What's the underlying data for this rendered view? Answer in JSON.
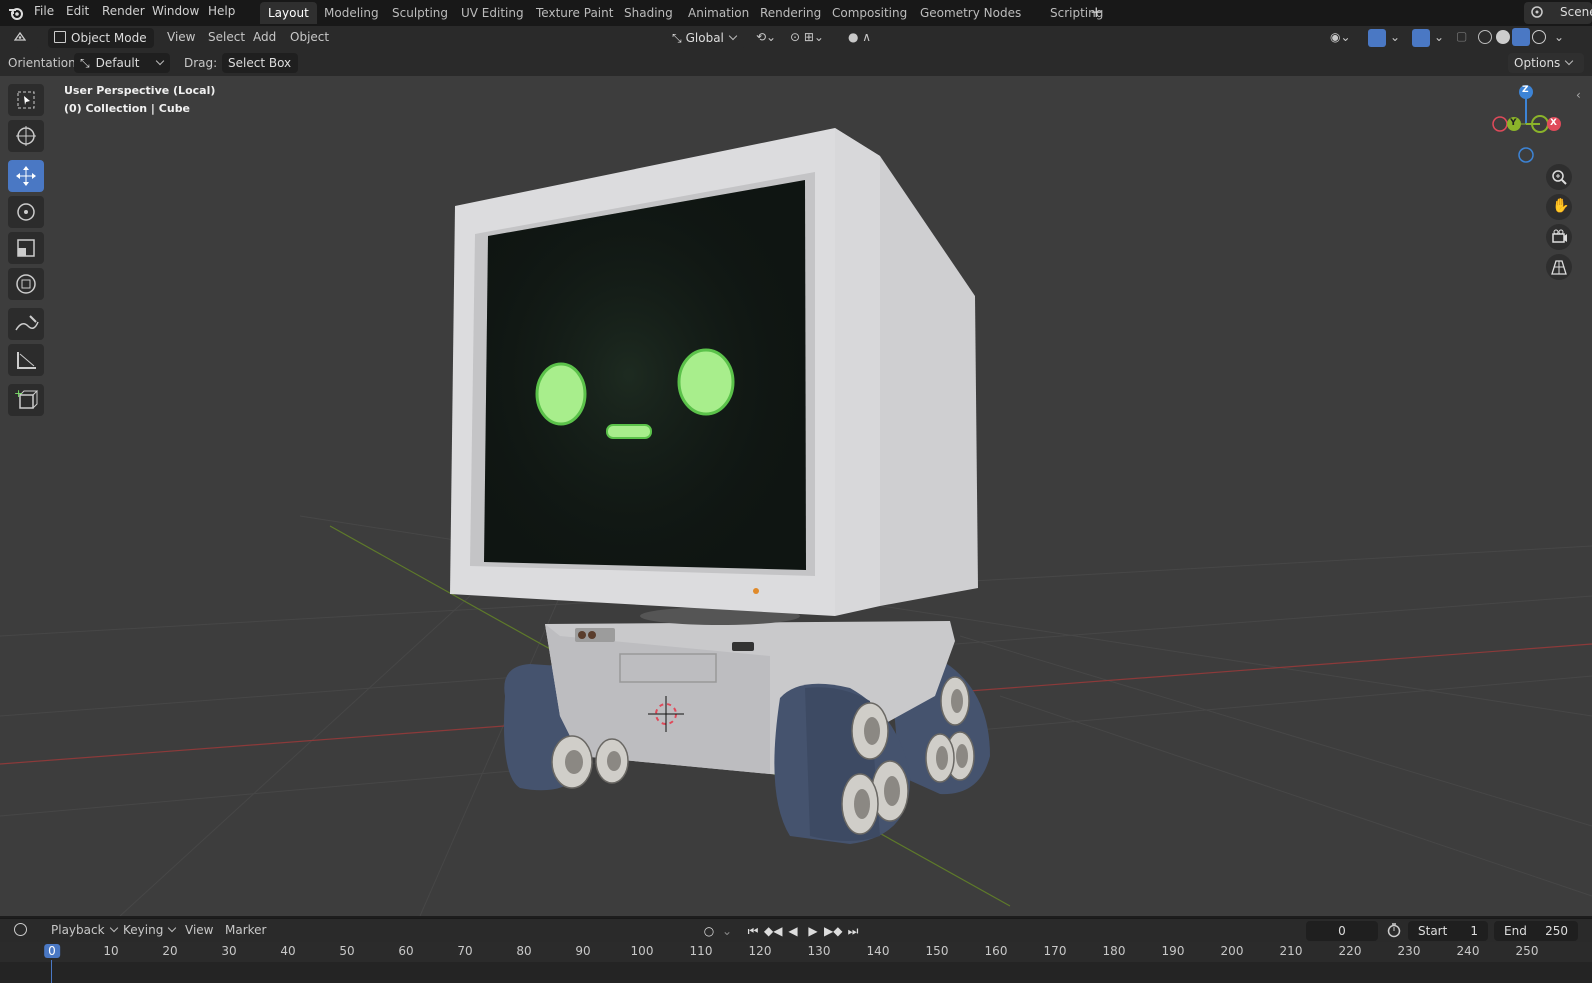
{
  "menu": [
    "File",
    "Edit",
    "Render",
    "Window",
    "Help"
  ],
  "workspaces": [
    "Layout",
    "Modeling",
    "Sculpting",
    "UV Editing",
    "Texture Paint",
    "Shading",
    "Animation",
    "Rendering",
    "Compositing",
    "Geometry Nodes",
    "Scripting"
  ],
  "active_workspace": "Layout",
  "scene_label": "Scene",
  "header": {
    "mode": "Object Mode",
    "menus": [
      "View",
      "Select",
      "Add",
      "Object"
    ],
    "transform_orientation": "Global"
  },
  "tool_settings": {
    "orientation_label": "Orientation:",
    "orientation_value": "Default",
    "drag_label": "Drag:",
    "drag_value": "Select Box",
    "options_label": "Options"
  },
  "viewport": {
    "view_name": "User Perspective (Local)",
    "collection_info": "(0) Collection | Cube"
  },
  "gizmo_axes": {
    "z": "Z",
    "y": "Y",
    "x": "X"
  },
  "timeline": {
    "menus": [
      "Playback",
      "Keying",
      "View",
      "Marker"
    ],
    "current_frame": "0",
    "start_label": "Start",
    "start_value": "1",
    "end_label": "End",
    "end_value": "250",
    "ticks": [
      "0",
      "10",
      "20",
      "30",
      "40",
      "50",
      "60",
      "70",
      "80",
      "90",
      "100",
      "110",
      "120",
      "130",
      "140",
      "150",
      "160",
      "170",
      "180",
      "190",
      "200",
      "210",
      "220",
      "230",
      "240",
      "250"
    ]
  },
  "colors": {
    "accent": "#4a78c4",
    "viewport_bg": "#3d3d3d",
    "screen_glow": "#7ee36b",
    "axis_x": "#e04a5a",
    "axis_y": "#8bb42a",
    "axis_z": "#3d84d6"
  }
}
